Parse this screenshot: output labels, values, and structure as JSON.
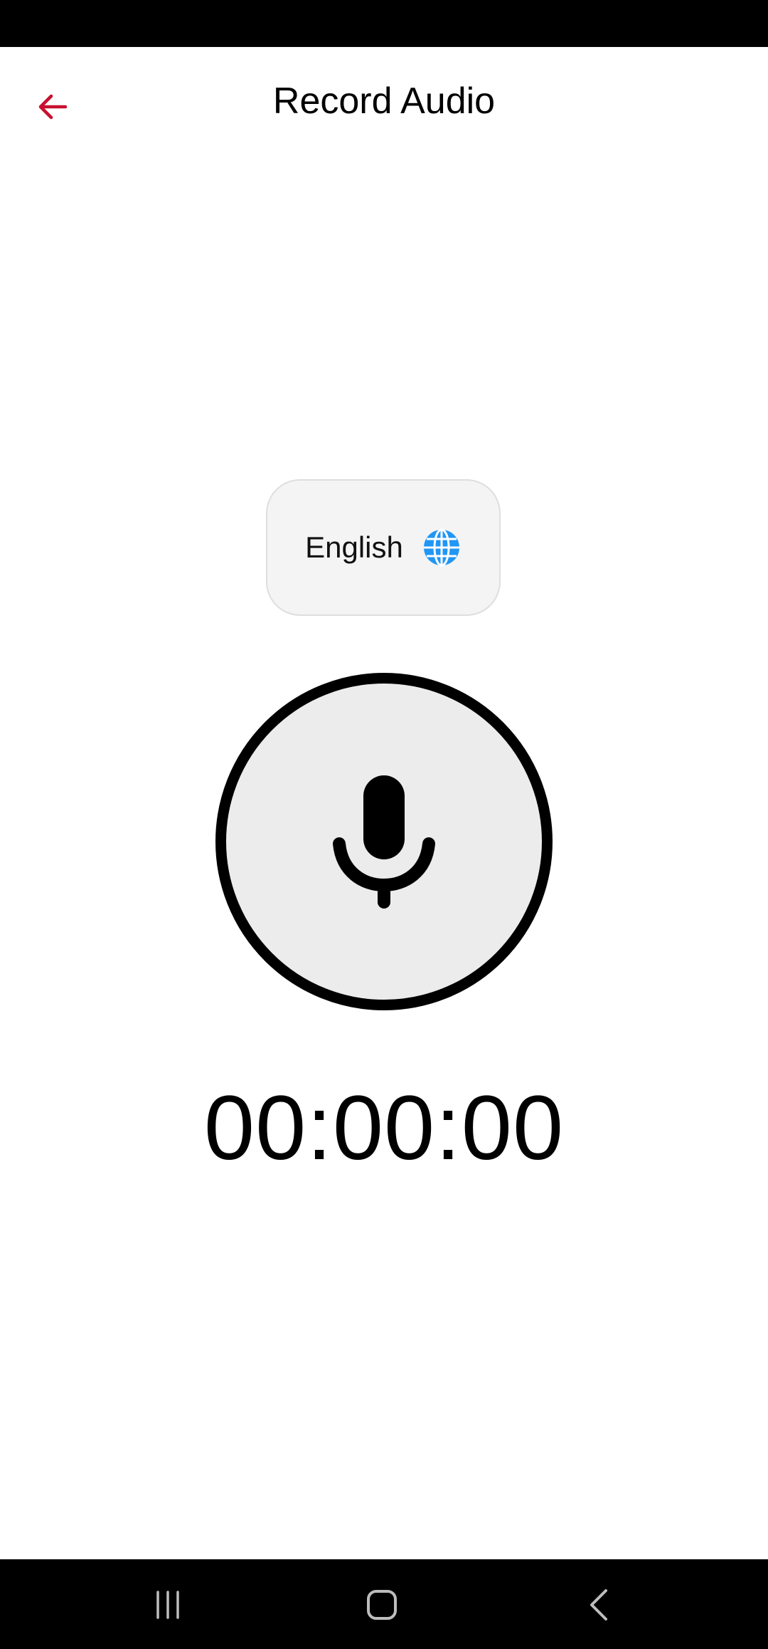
{
  "header": {
    "title": "Record Audio",
    "back_icon": "arrow-left-icon",
    "back_color": "#c8102e"
  },
  "language": {
    "label": "English",
    "icon": "globe-icon",
    "icon_color": "#2196f3"
  },
  "recorder": {
    "icon": "microphone-icon",
    "timer": "00:00:00"
  },
  "system_nav": {
    "recents_icon": "recents-icon",
    "home_icon": "home-icon",
    "back_icon": "back-chevron-icon"
  }
}
